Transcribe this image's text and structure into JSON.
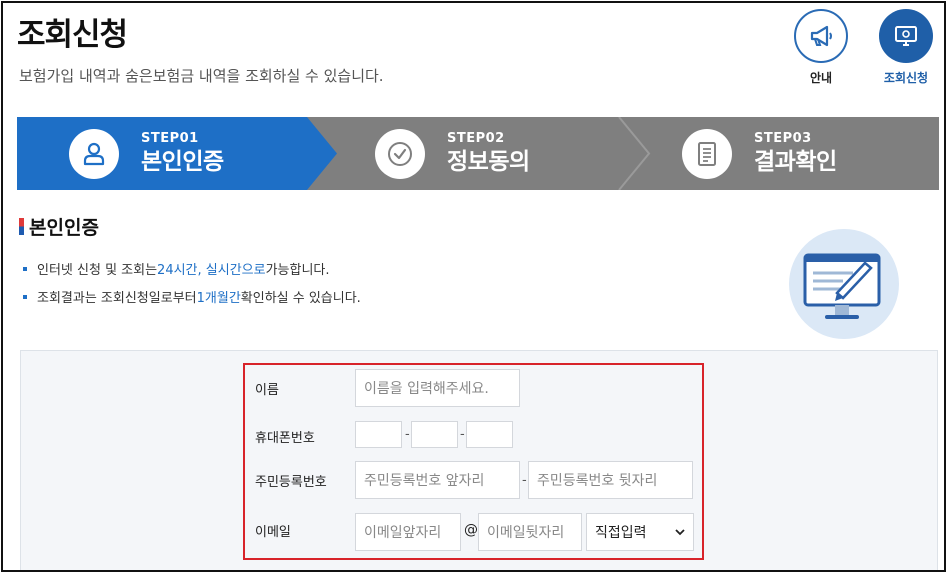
{
  "header": {
    "title": "조회신청",
    "subtitle": "보험가입 내역과 숨은보험금 내역을 조회하실 수 있습니다."
  },
  "top_buttons": {
    "guide_label": "안내",
    "apply_label": "조회신청"
  },
  "steps": [
    {
      "number": "STEP01",
      "name": "본인인증",
      "icon": "user-icon",
      "active": true
    },
    {
      "number": "STEP02",
      "name": "정보동의",
      "icon": "check-circle-icon",
      "active": false
    },
    {
      "number": "STEP03",
      "name": "결과확인",
      "icon": "document-icon",
      "active": false
    }
  ],
  "section": {
    "title": "본인인증",
    "notice1": {
      "pre": "인터넷 신청 및 조회는 ",
      "hl": "24시간, 실시간으로",
      "post": " 가능합니다."
    },
    "notice2": {
      "pre": "조회결과는 조회신청일로부터 ",
      "hl": "1개월간",
      "post": " 확인하실 수 있습니다."
    }
  },
  "form": {
    "name_label": "이름",
    "name_placeholder": "이름을 입력해주세요.",
    "phone_label": "휴대폰번호",
    "phone_sep": "-",
    "rrn_label": "주민등록번호",
    "rrn_front_placeholder": "주민등록번호 앞자리",
    "rrn_back_placeholder": "주민등록번호 뒷자리",
    "rrn_sep": "-",
    "email_label": "이메일",
    "email_front_placeholder": "이메일앞자리",
    "email_at": "@",
    "email_back_placeholder": "이메일뒷자리",
    "email_domain_selected": "직접입력"
  },
  "colors": {
    "accent": "#1e6fc6",
    "step_inactive": "#7f7f7f",
    "highlight_border": "#d8232a"
  }
}
